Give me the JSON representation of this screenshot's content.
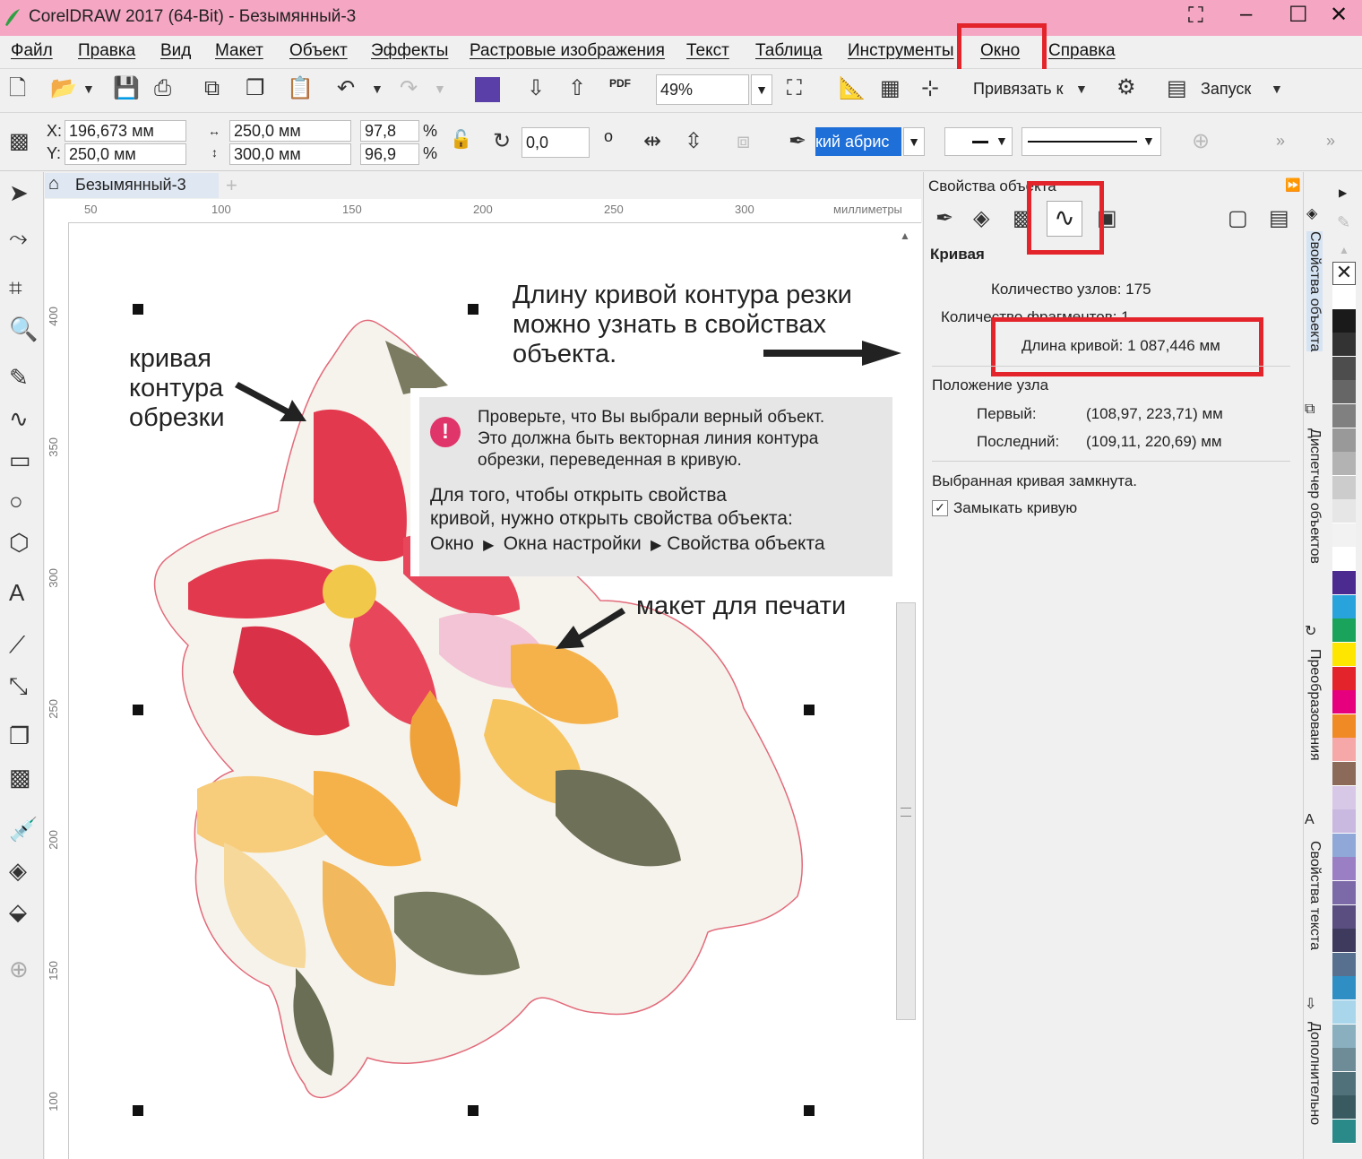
{
  "window": {
    "title": "CorelDRAW 2017 (64-Bit) - Безымянный-3"
  },
  "menu": [
    "Файл",
    "Правка",
    "Вид",
    "Макет",
    "Объект",
    "Эффекты",
    "Растровые изображения",
    "Текст",
    "Таблица",
    "Инструменты",
    "Окно",
    "Справка"
  ],
  "toolbar": {
    "zoom": "49%",
    "snap_label": "Привязать к",
    "launch_label": "Запуск",
    "pdf_label": "PDF"
  },
  "props": {
    "x_label": "X:",
    "y_label": "Y:",
    "x_value": "196,673 мм",
    "y_value": "250,0 мм",
    "width": "250,0 мм",
    "height": "300,0 мм",
    "scale_w": "97,8",
    "scale_h": "96,9",
    "pct": "%",
    "rotation": "0,0",
    "deg": "o",
    "outline": "кий абрис"
  },
  "document": {
    "tab": "Безымянный-3"
  },
  "ruler": {
    "h": [
      "50",
      "100",
      "150",
      "200",
      "250",
      "300"
    ],
    "unit": "миллиметры",
    "v": [
      "400",
      "350",
      "300",
      "250",
      "200",
      "150",
      "100"
    ]
  },
  "annotations": {
    "cut_curve": [
      "кривая",
      "контура",
      "обрезки"
    ],
    "length_hint": [
      "Длину кривой контура резки",
      "можно узнать в свойствах",
      "объекта."
    ],
    "print_layout": "макет для печати"
  },
  "callout": {
    "warn_glyph": "!",
    "warning": [
      "Проверьте, что Вы выбрали верный объект.",
      "Это должна быть векторная линия контура",
      "обрезки, переведенная в кривую."
    ],
    "howto": [
      "Для того, чтобы открыть свойства",
      "кривой, нужно открыть свойства объекта:"
    ],
    "path": [
      "Окно",
      "Окна настройки",
      "Свойства объекта"
    ]
  },
  "panel": {
    "title": "Свойства объекта",
    "section": "Кривая",
    "nodes": "Количество узлов: 175",
    "fragments": "Количество фрагментов: 1",
    "length": "Длина кривой: 1 087,446 мм",
    "node_pos": "Положение узла",
    "first_label": "Первый:",
    "first_value": "(108,97, 223,71) мм",
    "last_label": "Последний:",
    "last_value": "(109,11, 220,69) мм",
    "closed": "Выбранная кривая замкнута.",
    "close_checkbox": "Замыкать кривую"
  },
  "dockers": [
    "Свойства объекта",
    "Диспетчер объектов",
    "Преобразования",
    "Свойства текста",
    "Дополнительно"
  ],
  "palette": [
    "#ffffff",
    "#1a1a1a",
    "#333333",
    "#4d4d4d",
    "#666666",
    "#808080",
    "#999999",
    "#b3b3b3",
    "#cccccc",
    "#e6e6e6",
    "#f2f2f2",
    "#ffffff",
    "#4b2b8f",
    "#29a3dc",
    "#1aa35a",
    "#ffe600",
    "#e3242b",
    "#e6007e",
    "#f08a24",
    "#f6a7a7",
    "#8c6a5a",
    "#d8c8e8",
    "#c9b8e0",
    "#8fa8d8",
    "#9b7fc4",
    "#7c6aa8",
    "#5a4e80",
    "#3e3a5e",
    "#587090",
    "#2f8fc4",
    "#a9d6ea",
    "#8ab0c0",
    "#6e8c98",
    "#50707a",
    "#3a5a62",
    "#2a8a8a"
  ]
}
